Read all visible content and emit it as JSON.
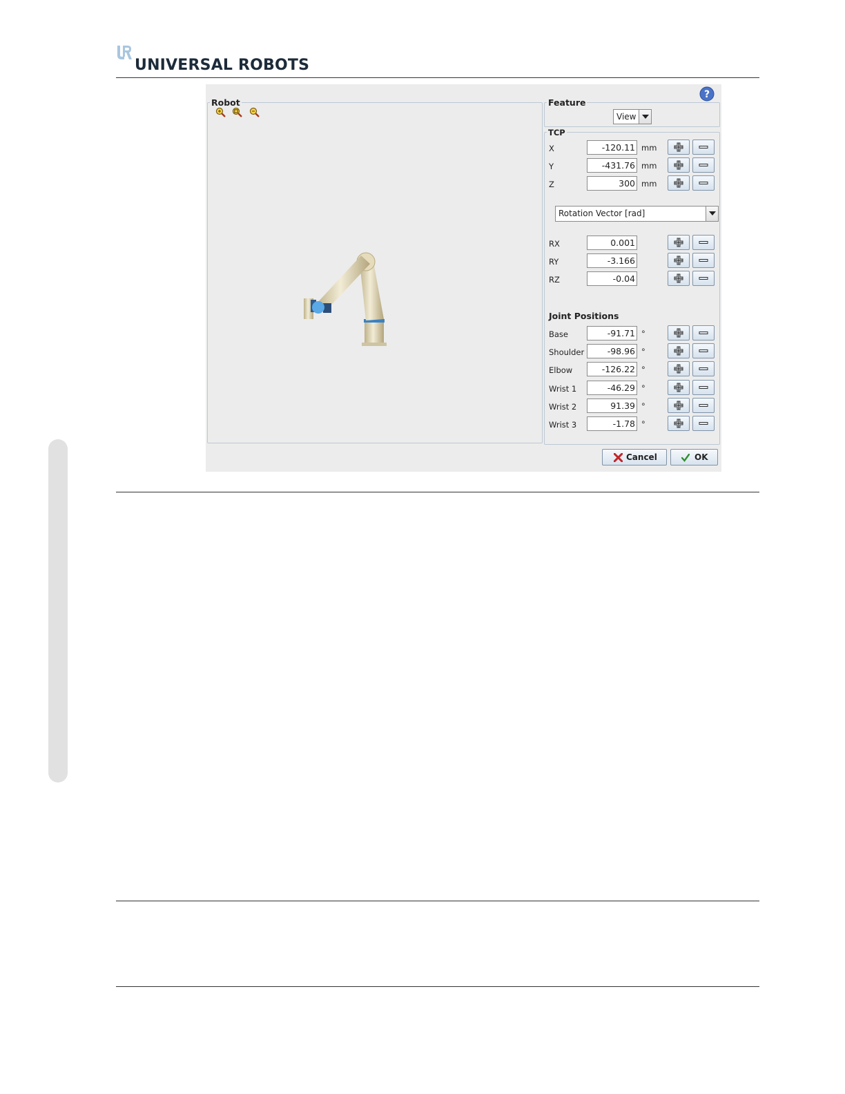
{
  "header": {
    "brand": "UNIVERSAL ROBOTS"
  },
  "dialog": {
    "robot_panel": {
      "title": "Robot"
    },
    "feature_panel": {
      "title": "Feature",
      "selected": "View"
    },
    "tcp": {
      "title": "TCP",
      "position": [
        {
          "axis": "X",
          "value": "-120.11",
          "unit": "mm"
        },
        {
          "axis": "Y",
          "value": "-431.76",
          "unit": "mm"
        },
        {
          "axis": "Z",
          "value": "300",
          "unit": "mm"
        }
      ],
      "rotation_mode": "Rotation Vector [rad]",
      "rotation": [
        {
          "axis": "RX",
          "value": "0.001"
        },
        {
          "axis": "RY",
          "value": "-3.166"
        },
        {
          "axis": "RZ",
          "value": "-0.04"
        }
      ]
    },
    "joints": {
      "title": "Joint Positions",
      "unit": "°",
      "items": [
        {
          "name": "Base",
          "value": "-91.71"
        },
        {
          "name": "Shoulder",
          "value": "-98.96"
        },
        {
          "name": "Elbow",
          "value": "-126.22"
        },
        {
          "name": "Wrist 1",
          "value": "-46.29"
        },
        {
          "name": "Wrist 2",
          "value": "91.39"
        },
        {
          "name": "Wrist 3",
          "value": "-1.78"
        }
      ]
    },
    "buttons": {
      "cancel": "Cancel",
      "ok": "OK"
    }
  },
  "icons": {
    "help": "help-icon",
    "zoom_in": "zoom-in-icon",
    "zoom_fit": "zoom-fit-icon",
    "zoom_out": "zoom-out-icon",
    "increment": "plus-icon",
    "decrement": "minus-icon",
    "dropdown": "chevron-down-icon",
    "cancel": "cross-icon",
    "ok": "check-icon"
  },
  "colors": {
    "dialog_bg": "#ececec",
    "group_border": "#bcc8d4",
    "button_border": "#7f93a8",
    "robot_body": "#e0d6b8",
    "robot_accent": "#3a82c4",
    "help_blue": "#4a73c8",
    "cancel_red": "#c0262a",
    "ok_green": "#2f8f2f"
  }
}
